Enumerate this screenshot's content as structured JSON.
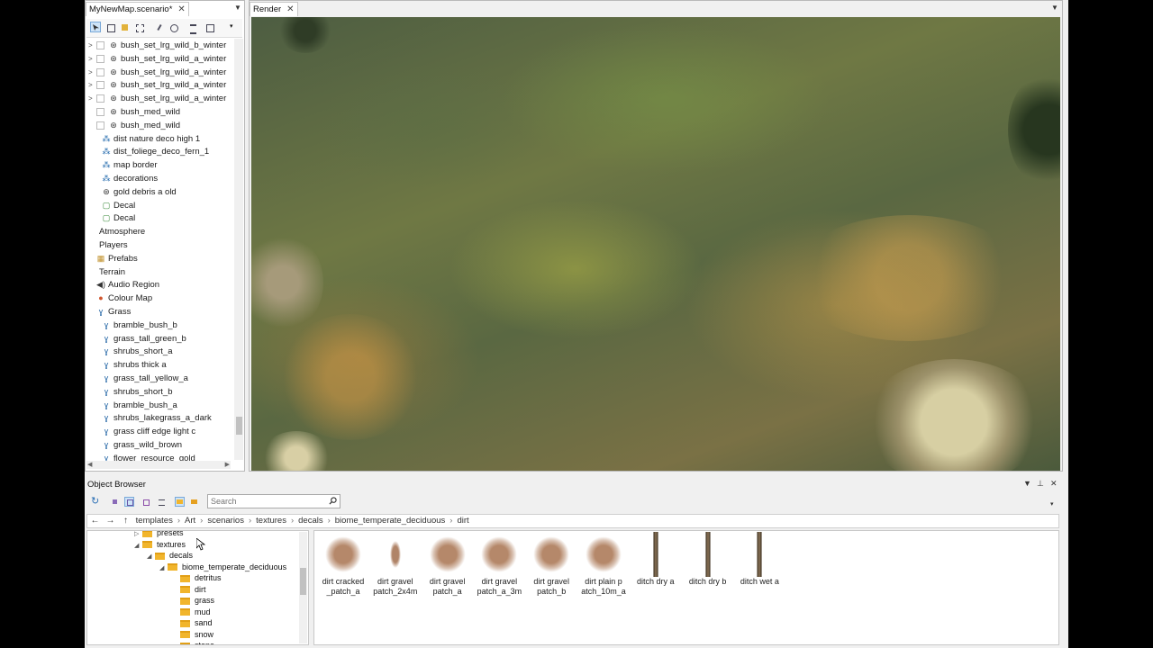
{
  "scene": {
    "tab_label": "MyNewMap.scenario*",
    "tree": [
      {
        "label": "bush_set_lrg_wild_b_winter",
        "indent": 1,
        "arrow": ">",
        "icon": "object"
      },
      {
        "label": "bush_set_lrg_wild_a_winter",
        "indent": 1,
        "arrow": ">",
        "icon": "object"
      },
      {
        "label": "bush_set_lrg_wild_a_winter",
        "indent": 1,
        "arrow": ">",
        "icon": "object"
      },
      {
        "label": "bush_set_lrg_wild_a_winter",
        "indent": 1,
        "arrow": ">",
        "icon": "object"
      },
      {
        "label": "bush_set_lrg_wild_a_winter",
        "indent": 1,
        "arrow": ">",
        "icon": "object"
      },
      {
        "label": "bush_med_wild",
        "indent": 1,
        "arrow": "",
        "icon": "object"
      },
      {
        "label": "bush_med_wild",
        "indent": 1,
        "arrow": "",
        "icon": "object"
      },
      {
        "label": "dist nature deco high 1",
        "indent": 0,
        "arrow": "",
        "icon": "group"
      },
      {
        "label": "dist_foliege_deco_fern_1",
        "indent": 0,
        "arrow": "",
        "icon": "group"
      },
      {
        "label": "map border",
        "indent": 0,
        "arrow": "",
        "icon": "group"
      },
      {
        "label": "decorations",
        "indent": 0,
        "arrow": "",
        "icon": "group"
      },
      {
        "label": "gold debris a old",
        "indent": 0,
        "arrow": "",
        "icon": "object"
      },
      {
        "label": "Decal",
        "indent": 0,
        "arrow": "",
        "icon": "decal"
      },
      {
        "label": "Decal",
        "indent": 0,
        "arrow": "",
        "icon": "decal"
      },
      {
        "label": "Atmosphere",
        "indent": -1,
        "arrow": "",
        "icon": ""
      },
      {
        "label": "Players",
        "indent": -1,
        "arrow": "",
        "icon": ""
      },
      {
        "label": "Prefabs",
        "indent": -1,
        "arrow": "",
        "icon": "prefab"
      },
      {
        "label": "Terrain",
        "indent": -1,
        "arrow": "",
        "icon": ""
      },
      {
        "label": "Audio Region",
        "indent": -1,
        "arrow": "",
        "icon": "audio"
      },
      {
        "label": "Colour Map",
        "indent": -1,
        "arrow": "",
        "icon": "colour"
      },
      {
        "label": "Grass",
        "indent": -1,
        "arrow": "",
        "icon": "grass"
      },
      {
        "label": "bramble_bush_b",
        "indent": 0,
        "arrow": "",
        "icon": "grass"
      },
      {
        "label": "grass_tall_green_b",
        "indent": 0,
        "arrow": "",
        "icon": "grass"
      },
      {
        "label": "shrubs_short_a",
        "indent": 0,
        "arrow": "",
        "icon": "grass"
      },
      {
        "label": "shrubs thick a",
        "indent": 0,
        "arrow": "",
        "icon": "grass"
      },
      {
        "label": "grass_tall_yellow_a",
        "indent": 0,
        "arrow": "",
        "icon": "grass"
      },
      {
        "label": "shrubs_short_b",
        "indent": 0,
        "arrow": "",
        "icon": "grass"
      },
      {
        "label": "bramble_bush_a",
        "indent": 0,
        "arrow": "",
        "icon": "grass"
      },
      {
        "label": "shrubs_lakegrass_a_dark",
        "indent": 0,
        "arrow": "",
        "icon": "grass"
      },
      {
        "label": "grass cliff edge light c",
        "indent": 0,
        "arrow": "",
        "icon": "grass"
      },
      {
        "label": "grass_wild_brown",
        "indent": 0,
        "arrow": "",
        "icon": "grass"
      },
      {
        "label": "flower_resource_gold",
        "indent": 0,
        "arrow": "",
        "icon": "grass"
      }
    ]
  },
  "render": {
    "tab_label": "Render"
  },
  "object_browser": {
    "title": "Object Browser",
    "search_placeholder": "Search",
    "breadcrumb": [
      "templates",
      "Art",
      "scenarios",
      "textures",
      "decals",
      "biome_temperate_deciduous",
      "dirt"
    ],
    "dir_tree": [
      {
        "label": "presets",
        "depth": 0,
        "arrow": "▷"
      },
      {
        "label": "textures",
        "depth": 0,
        "arrow": "◢"
      },
      {
        "label": "decals",
        "depth": 1,
        "arrow": "◢"
      },
      {
        "label": "biome_temperate_deciduous",
        "depth": 2,
        "arrow": "◢"
      },
      {
        "label": "detritus",
        "depth": 3,
        "arrow": ""
      },
      {
        "label": "dirt",
        "depth": 3,
        "arrow": ""
      },
      {
        "label": "grass",
        "depth": 3,
        "arrow": ""
      },
      {
        "label": "mud",
        "depth": 3,
        "arrow": ""
      },
      {
        "label": "sand",
        "depth": 3,
        "arrow": ""
      },
      {
        "label": "snow",
        "depth": 3,
        "arrow": ""
      },
      {
        "label": "stone",
        "depth": 3,
        "arrow": ""
      }
    ],
    "assets": [
      {
        "label": "dirt cracked\n_patch_a",
        "kind": "round"
      },
      {
        "label": "dirt gravel\npatch_2x4m",
        "kind": "tall"
      },
      {
        "label": "dirt gravel\npatch_a",
        "kind": "round"
      },
      {
        "label": "dirt gravel\npatch_a_3m",
        "kind": "round"
      },
      {
        "label": "dirt gravel\npatch_b",
        "kind": "round"
      },
      {
        "label": "dirt plain p\natch_10m_a",
        "kind": "round"
      },
      {
        "label": "ditch dry a",
        "kind": "strip"
      },
      {
        "label": "ditch dry b",
        "kind": "strip"
      },
      {
        "label": "ditch wet a",
        "kind": "strip"
      }
    ]
  },
  "colors": {
    "accent": "#cde3f7",
    "folder": "#f1b52c",
    "dirt": "#b5886a"
  }
}
